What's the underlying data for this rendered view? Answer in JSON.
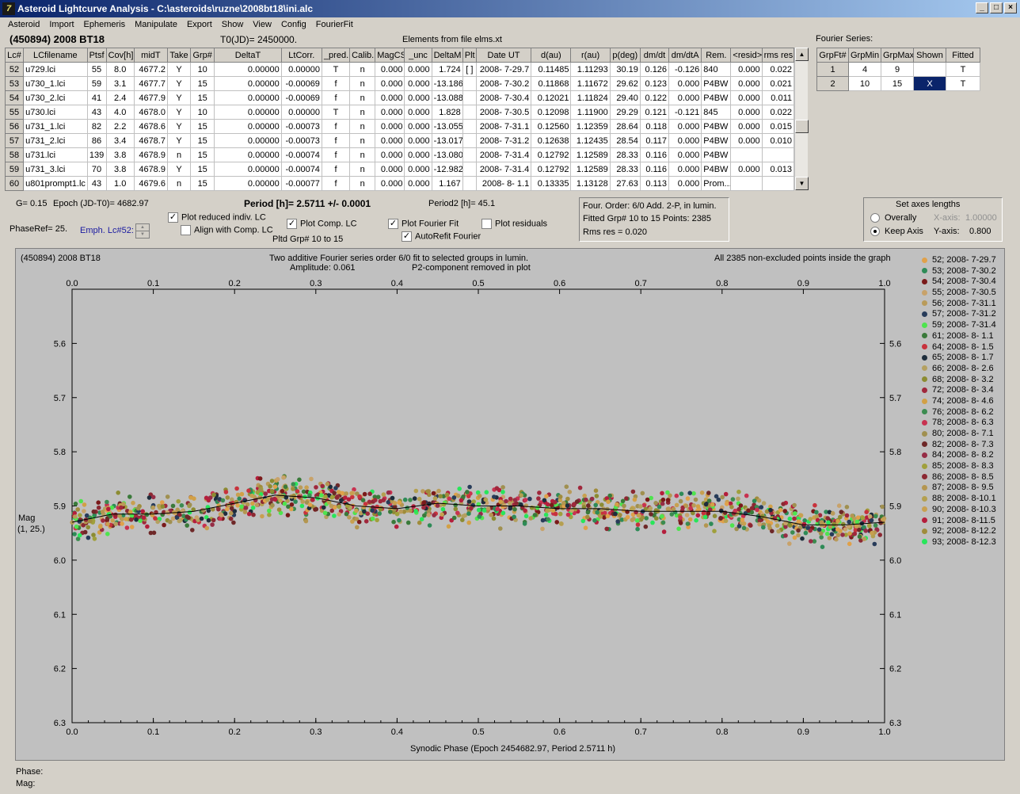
{
  "window": {
    "title": "Asteroid Lightcurve Analysis - C:\\asteroids\\ruzne\\2008bt18\\ini.alc",
    "icon": "7"
  },
  "menu": [
    "Asteroid",
    "Import",
    "Ephemeris",
    "Manipulate",
    "Export",
    "Show",
    "View",
    "Config",
    "FourierFit"
  ],
  "header": {
    "asteroid": "(450894) 2008 BT18",
    "t0": "T0(JD)= 2450000.",
    "elements": "Elements from file elms.xt"
  },
  "table": {
    "columns": [
      "Lc#",
      "LCfilename",
      "Ptsf",
      "Cov[h]",
      "midT",
      "Take",
      "Grp#",
      "DeltaT",
      "LtCorr.",
      "_pred.",
      "Calib.",
      "MagCS",
      "_unc",
      "DeltaM",
      "Plt",
      "Date UT",
      "d(au)",
      "r(au)",
      "p(deg)",
      "dm/dt",
      "dm/dtA",
      "Rem.",
      "<resid>",
      "rms res"
    ],
    "rows": [
      [
        "52",
        "u729.lci",
        "55",
        "8.0",
        "4677.2",
        "Y",
        "10",
        "0.00000",
        "0.00000",
        "T",
        "n",
        "0.000",
        "0.000",
        "1.724",
        "[ ]",
        "2008- 7-29.7",
        "0.11485",
        "1.11293",
        "30.19",
        "0.126",
        "-0.126",
        "840",
        "0.000",
        "0.022"
      ],
      [
        "53",
        "u730_1.lci",
        "59",
        "3.1",
        "4677.7",
        "Y",
        "15",
        "0.00000",
        "-0.00069",
        "f",
        "n",
        "0.000",
        "0.000",
        "-13.186",
        "",
        "2008- 7-30.2",
        "0.11868",
        "1.11672",
        "29.62",
        "0.123",
        "0.000",
        "P4BW",
        "0.000",
        "0.021"
      ],
      [
        "54",
        "u730_2.lci",
        "41",
        "2.4",
        "4677.9",
        "Y",
        "15",
        "0.00000",
        "-0.00069",
        "f",
        "n",
        "0.000",
        "0.000",
        "-13.088",
        "",
        "2008- 7-30.4",
        "0.12021",
        "1.11824",
        "29.40",
        "0.122",
        "0.000",
        "P4BW",
        "0.000",
        "0.011"
      ],
      [
        "55",
        "u730.lci",
        "43",
        "4.0",
        "4678.0",
        "Y",
        "10",
        "0.00000",
        "0.00000",
        "T",
        "n",
        "0.000",
        "0.000",
        "1.828",
        "",
        "2008- 7-30.5",
        "0.12098",
        "1.11900",
        "29.29",
        "0.121",
        "-0.121",
        "845",
        "0.000",
        "0.022"
      ],
      [
        "56",
        "u731_1.lci",
        "82",
        "2.2",
        "4678.6",
        "Y",
        "15",
        "0.00000",
        "-0.00073",
        "f",
        "n",
        "0.000",
        "0.000",
        "-13.055",
        "",
        "2008- 7-31.1",
        "0.12560",
        "1.12359",
        "28.64",
        "0.118",
        "0.000",
        "P4BW",
        "0.000",
        "0.015"
      ],
      [
        "57",
        "u731_2.lci",
        "86",
        "3.4",
        "4678.7",
        "Y",
        "15",
        "0.00000",
        "-0.00073",
        "f",
        "n",
        "0.000",
        "0.000",
        "-13.017",
        "",
        "2008- 7-31.2",
        "0.12638",
        "1.12435",
        "28.54",
        "0.117",
        "0.000",
        "P4BW",
        "0.000",
        "0.010"
      ],
      [
        "58",
        "u731.lci",
        "139",
        "3.8",
        "4678.9",
        "n",
        "15",
        "0.00000",
        "-0.00074",
        "f",
        "n",
        "0.000",
        "0.000",
        "-13.080",
        "",
        "2008- 7-31.4",
        "0.12792",
        "1.12589",
        "28.33",
        "0.116",
        "0.000",
        "P4BW",
        "",
        ""
      ],
      [
        "59",
        "u731_3.lci",
        "70",
        "3.8",
        "4678.9",
        "Y",
        "15",
        "0.00000",
        "-0.00074",
        "f",
        "n",
        "0.000",
        "0.000",
        "-12.982",
        "",
        "2008- 7-31.4",
        "0.12792",
        "1.12589",
        "28.33",
        "0.116",
        "0.000",
        "P4BW",
        "0.000",
        "0.013"
      ],
      [
        "60",
        "u801prompt1.lc",
        "43",
        "1.0",
        "4679.6",
        "n",
        "15",
        "0.00000",
        "-0.00077",
        "f",
        "n",
        "0.000",
        "0.000",
        "1.167",
        "",
        "2008- 8- 1.1",
        "0.13335",
        "1.13128",
        "27.63",
        "0.113",
        "0.000",
        "Prom...",
        "",
        ""
      ]
    ]
  },
  "fourier": {
    "title": "Fourier Series:",
    "columns": [
      "GrpFt#",
      "GrpMin",
      "GrpMax",
      "Shown",
      "Fitted"
    ],
    "rows": [
      [
        "1",
        "4",
        "9",
        "",
        "T"
      ],
      [
        "2",
        "10",
        "15",
        "X",
        "T"
      ]
    ]
  },
  "controls": {
    "g": "G= 0.15",
    "epoch": "Epoch (JD-T0)= 4682.97",
    "period": "Period [h]= 2.5711 +/- 0.0001",
    "period2": "Period2 [h]= 45.1",
    "phaseref": "PhaseRef= 25.",
    "emph": "Emph. Lc#52:",
    "plot_reduced": "Plot reduced indiv. LC",
    "align": "Align with Comp. LC",
    "plot_comp": "Plot Comp. LC",
    "plot_fourier": "Plot Fourier Fit",
    "plot_resid": "Plot residuals",
    "autorefit": "AutoRefit Fourier",
    "pltd_grp": "Pltd Grp#  10 to   15"
  },
  "info": {
    "line1": "Four. Order:  6/0      Add. 2-P, in lumin.",
    "line2": "Fitted Grp# 10 to 15 Points: 2385",
    "line3": "Rms res      = 0.020"
  },
  "axes_box": {
    "title": "Set axes lengths",
    "overally": "Overally",
    "keep": "Keep Axis",
    "xlabel": "X-axis:",
    "xval": "1.00000",
    "ylabel": "Y-axis:",
    "yval": "0.800"
  },
  "plot": {
    "name": "(450894) 2008 BT18",
    "desc1": "Two additive Fourier series order 6/0 fit to selected groups in lumin.",
    "amp": "Amplitude: 0.061",
    "p2": "P2-component removed in plot",
    "points_note": "All 2385 non-excluded points inside the graph",
    "ylabel1": "Mag",
    "ylabel2": "(1, 25.)",
    "xlabel": "Synodic Phase (Epoch 2454682.97, Period 2.5711 h)"
  },
  "chart_data": {
    "type": "scatter",
    "xlim": [
      0,
      1
    ],
    "ylim": [
      5.5,
      6.3
    ],
    "y_inverted": true,
    "x_ticks": [
      "0.0",
      "0.1",
      "0.2",
      "0.3",
      "0.4",
      "0.5",
      "0.6",
      "0.7",
      "0.8",
      "0.9",
      "1.0"
    ],
    "y_ticks": [
      "5.6",
      "5.7",
      "5.8",
      "5.9",
      "6.0",
      "6.1",
      "6.2",
      "6.3"
    ],
    "n_points": 2385,
    "fit_curve": {
      "x": [
        0.0,
        0.05,
        0.1,
        0.15,
        0.2,
        0.25,
        0.3,
        0.35,
        0.4,
        0.45,
        0.5,
        0.55,
        0.6,
        0.65,
        0.7,
        0.75,
        0.8,
        0.85,
        0.9,
        0.95,
        1.0
      ],
      "y": [
        5.93,
        5.915,
        5.915,
        5.91,
        5.895,
        5.88,
        5.885,
        5.9,
        5.905,
        5.895,
        5.9,
        5.9,
        5.905,
        5.905,
        5.91,
        5.91,
        5.91,
        5.92,
        5.935,
        5.935,
        5.93
      ]
    },
    "legend": [
      {
        "label": "52; 2008- 7-29.7",
        "color": "#e0a14a"
      },
      {
        "label": "53; 2008- 7-30.2",
        "color": "#2e8b57"
      },
      {
        "label": "54; 2008- 7-30.4",
        "color": "#7a1a1a"
      },
      {
        "label": "55; 2008- 7-30.5",
        "color": "#c8a26a"
      },
      {
        "label": "56; 2008- 7-31.1",
        "color": "#b99b5a"
      },
      {
        "label": "57; 2008- 7-31.2",
        "color": "#283c5a"
      },
      {
        "label": "59; 2008- 7-31.4",
        "color": "#4ee44e"
      },
      {
        "label": "61; 2008- 8- 1.1",
        "color": "#3a7a3a"
      },
      {
        "label": "64; 2008- 8- 1.5",
        "color": "#c8323c"
      },
      {
        "label": "65; 2008- 8- 1.7",
        "color": "#1e2d3c"
      },
      {
        "label": "66; 2008- 8- 2.6",
        "color": "#b4a060"
      },
      {
        "label": "68; 2008- 8- 3.2",
        "color": "#8c8c32"
      },
      {
        "label": "72; 2008- 8- 3.4",
        "color": "#a0283c"
      },
      {
        "label": "74; 2008- 8- 4.6",
        "color": "#d2a046"
      },
      {
        "label": "76; 2008- 8- 6.2",
        "color": "#3c8c50"
      },
      {
        "label": "78; 2008- 8- 6.3",
        "color": "#c83250"
      },
      {
        "label": "80; 2008- 8- 7.1",
        "color": "#a09050"
      },
      {
        "label": "82; 2008- 8- 7.3",
        "color": "#6e2828"
      },
      {
        "label": "84; 2008- 8- 8.2",
        "color": "#962d46"
      },
      {
        "label": "85; 2008- 8- 8.3",
        "color": "#a0a03c"
      },
      {
        "label": "86; 2008- 8- 8.5",
        "color": "#8c2832"
      },
      {
        "label": "87; 2008- 8- 9.5",
        "color": "#b49650"
      },
      {
        "label": "88; 2008- 8-10.1",
        "color": "#b4a050"
      },
      {
        "label": "90; 2008- 8-10.3",
        "color": "#c8a050"
      },
      {
        "label": "91; 2008- 8-11.5",
        "color": "#b41e3c"
      },
      {
        "label": "92; 2008- 8-12.2",
        "color": "#a08c3c"
      },
      {
        "label": "93; 2008- 8-12.3",
        "color": "#28e65a"
      }
    ]
  },
  "status": {
    "phase": "Phase:",
    "mag": "Mag:"
  }
}
